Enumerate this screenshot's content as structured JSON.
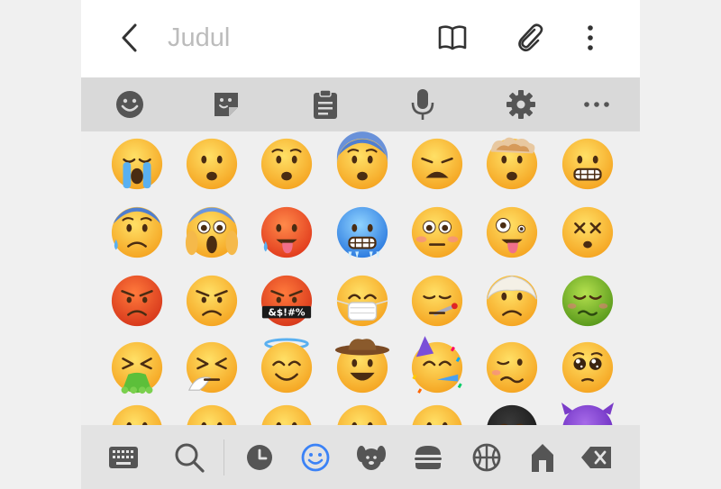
{
  "titlebar": {
    "back_icon": "chevron-left-icon",
    "title_placeholder": "Judul",
    "actions": [
      "book-icon",
      "paperclip-icon",
      "more-vertical-icon"
    ]
  },
  "toolbar": {
    "items": [
      "emoji-smile-icon",
      "sticker-icon",
      "clipboard-icon",
      "microphone-icon",
      "gear-icon",
      "more-horizontal-icon"
    ]
  },
  "emoji_grid": {
    "rows": [
      [
        "😭",
        "😦",
        "😧",
        "😨",
        "😩",
        "🤯",
        "😬"
      ],
      [
        "😰",
        "😱",
        "🥵",
        "🥶",
        "😳",
        "🤪",
        "😵"
      ],
      [
        "😡",
        "😠",
        "🤬",
        "😷",
        "🤒",
        "🤕",
        "🤢"
      ],
      [
        "🤮",
        "🤧",
        "😇",
        "🤠",
        "🥳",
        "🥴",
        "🥺"
      ],
      [
        "🤥",
        "🤫",
        "🤭",
        "🧐",
        "🤓",
        "😈",
        "👿"
      ]
    ],
    "censor_text": "&$!#%"
  },
  "bottombar": {
    "items": [
      "keyboard-icon",
      "search-icon",
      "clock-icon",
      "smiley-icon",
      "dog-icon",
      "burger-icon",
      "basketball-icon",
      "building-icon",
      "backspace-icon"
    ],
    "active": "smiley-icon",
    "active_color": "#3b82f6",
    "icon_color": "#5f6368"
  },
  "colors": {
    "title_placeholder": "#bcbcbc",
    "toolbar_bg": "#d9d9d9",
    "grid_bg": "#efefef",
    "bottombar_bg": "#e3e3e3"
  }
}
